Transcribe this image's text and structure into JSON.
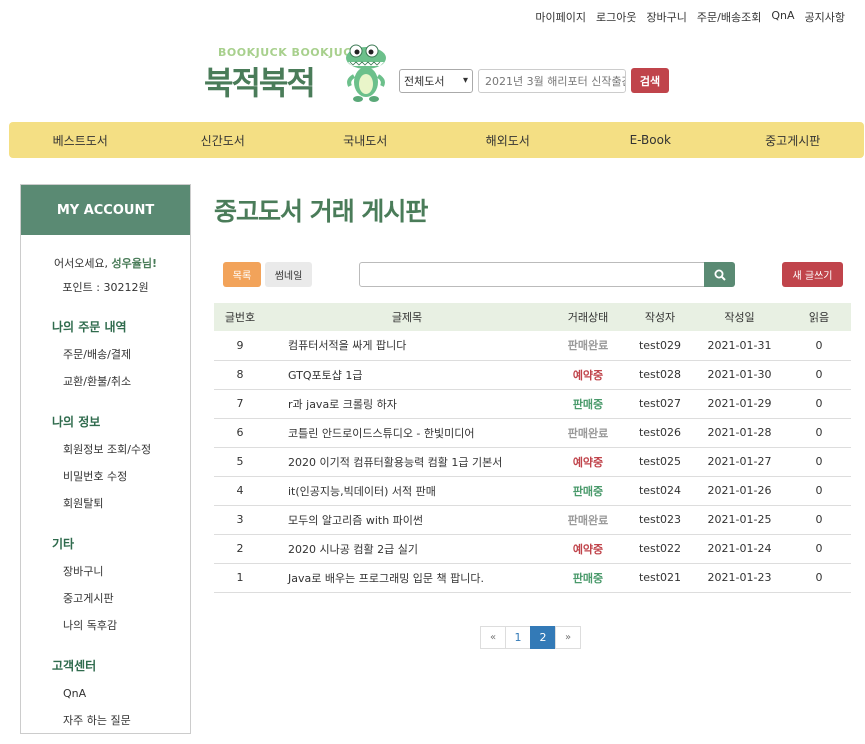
{
  "top_links": [
    "마이페이지",
    "로그아웃",
    "장바구니",
    "주문/배송조회",
    "QnA",
    "공지사항"
  ],
  "logo": {
    "sub": "BOOKJUCK BOOKJUCK",
    "main": "북적북적"
  },
  "search": {
    "category": "전체도서",
    "placeholder": "2021년 3월 해리포터 신작출간!",
    "button": "검색"
  },
  "nav": [
    "베스트도서",
    "신간도서",
    "국내도서",
    "해외도서",
    "E-Book",
    "중고게시판"
  ],
  "sidebar": {
    "title": "MY ACCOUNT",
    "welcome_prefix": "어서오세요, ",
    "user_name": "성우율님!",
    "points": "포인트 : 30212원",
    "sections": [
      {
        "title": "나의 주문 내역",
        "items": [
          "주문/배송/결제",
          "교환/환불/취소"
        ]
      },
      {
        "title": "나의 정보",
        "items": [
          "회원정보 조회/수정",
          "비밀번호 수정",
          "회원탈퇴"
        ]
      },
      {
        "title": "기타",
        "items": [
          "장바구니",
          "중고게시판",
          "나의 독후감"
        ]
      },
      {
        "title": "고객센터",
        "items": [
          "QnA",
          "자주 하는 질문"
        ]
      }
    ]
  },
  "main": {
    "title": "중고도서 거래 게시판",
    "btn_list": "목록",
    "btn_thumb": "썸네일",
    "btn_write": "새 글쓰기",
    "columns": [
      "글번호",
      "글제목",
      "거래상태",
      "작성자",
      "작성일",
      "읽음"
    ],
    "rows": [
      {
        "no": "9",
        "title": "컴퓨터서적을 싸게 팝니다",
        "status": "판매완료",
        "author": "test029",
        "date": "2021-01-31",
        "read": "0"
      },
      {
        "no": "8",
        "title": "GTQ포토샵 1급",
        "status": "예약중",
        "author": "test028",
        "date": "2021-01-30",
        "read": "0"
      },
      {
        "no": "7",
        "title": "r과 java로 크롤링 하자",
        "status": "판매중",
        "author": "test027",
        "date": "2021-01-29",
        "read": "0"
      },
      {
        "no": "6",
        "title": "코틀린 안드로이드스튜디오 - 한빛미디어",
        "status": "판매완료",
        "author": "test026",
        "date": "2021-01-28",
        "read": "0"
      },
      {
        "no": "5",
        "title": "2020 이기적 컴퓨터활용능력 컴활 1급 기본서",
        "status": "예약중",
        "author": "test025",
        "date": "2021-01-27",
        "read": "0"
      },
      {
        "no": "4",
        "title": "it(인공지능,빅데이터) 서적 판매",
        "status": "판매중",
        "author": "test024",
        "date": "2021-01-26",
        "read": "0"
      },
      {
        "no": "3",
        "title": "모두의 알고리즘 with 파이썬",
        "status": "판매완료",
        "author": "test023",
        "date": "2021-01-25",
        "read": "0"
      },
      {
        "no": "2",
        "title": "2020 시나공 컴활 2급 실기",
        "status": "예약중",
        "author": "test022",
        "date": "2021-01-24",
        "read": "0"
      },
      {
        "no": "1",
        "title": "Java로 배우는 프로그래밍 입문 책 팝니다.",
        "status": "판매중",
        "author": "test021",
        "date": "2021-01-23",
        "read": "0"
      }
    ],
    "status_colors": {
      "판매완료": "#999999",
      "예약중": "#c0444b",
      "판매중": "#4a9a6b"
    },
    "pagination": {
      "prev": "«",
      "pages": [
        "1",
        "2"
      ],
      "current": "2",
      "next": "»"
    }
  }
}
